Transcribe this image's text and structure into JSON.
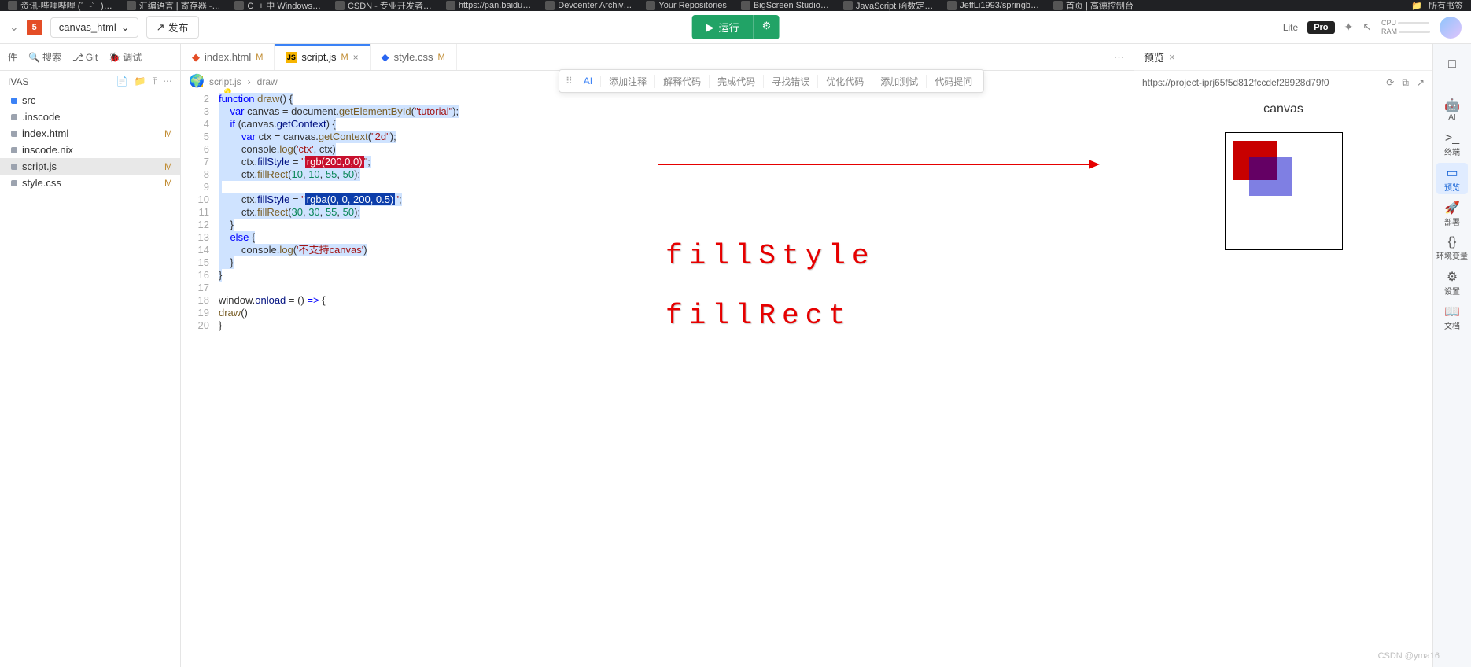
{
  "browser_tabs": [
    "资讯-哔哩哔哩 (゜-゜)…",
    "汇编语言 | 寄存器 -…",
    "C++ 中 Windows…",
    "CSDN - 专业开发者…",
    "https://pan.baidu…",
    "Devcenter Archiv…",
    "Your Repositories",
    "BigScreen Studio…",
    "JavaScript 函数定…",
    "JeffLi1993/springb…",
    "首页 | 高德控制台"
  ],
  "browser_right": "所有书签",
  "toolbar": {
    "project_name": "canvas_html",
    "publish": "发布",
    "run": "运行",
    "lite": "Lite",
    "pro": "Pro",
    "cpu": "CPU",
    "ram": "RAM"
  },
  "left_head": {
    "file": "件",
    "search": "搜索",
    "git": "Git",
    "debug": "调试"
  },
  "tree_title": "IVAS",
  "tree": [
    {
      "name": "src",
      "type": "folder",
      "mod": ""
    },
    {
      "name": ".inscode",
      "type": "file",
      "mod": ""
    },
    {
      "name": "index.html",
      "type": "file",
      "mod": "M"
    },
    {
      "name": "inscode.nix",
      "type": "file",
      "mod": ""
    },
    {
      "name": "script.js",
      "type": "file",
      "mod": "M",
      "active": true
    },
    {
      "name": "style.css",
      "type": "file",
      "mod": "M"
    }
  ],
  "editor_tabs": [
    {
      "label": "index.html",
      "mod": "M",
      "icon": "html"
    },
    {
      "label": "script.js",
      "mod": "M",
      "icon": "js",
      "active": true,
      "closable": true
    },
    {
      "label": "style.css",
      "mod": "M",
      "icon": "css"
    }
  ],
  "breadcrumb": {
    "file": "script.js",
    "symbol": "draw",
    "icon": "JS"
  },
  "helper": [
    "AI",
    "添加注释",
    "解释代码",
    "完成代码",
    "寻找错误",
    "优化代码",
    "添加测试",
    "代码提问"
  ],
  "gutter_start": 2,
  "gutter_end": 20,
  "code_raw": "function draw() {\n    var canvas = document.getElementById(\"tutorial\");\n    if (canvas.getContext) {\n        var ctx = canvas.getContext(\"2d\");\n        console.log('ctx', ctx)\n        ctx.fillStyle = \"rgb(200,0,0)\";\n        ctx.fillRect(10, 10, 55, 50);\n\n        ctx.fillStyle = \"rgba(0, 0, 200, 0.5)\";\n        ctx.fillRect(30, 30, 55, 50);\n    }\n    else {\n        console.log('不支持canvas')\n    }\n}\n\nwindow.onload = () => {\n    draw()\n}",
  "annotations": {
    "a1": "fillStyle",
    "a2": "fillRect"
  },
  "preview": {
    "title": "预览",
    "url": "https://project-iprj65f5d812fccdef28928d79f0",
    "page_title": "canvas"
  },
  "rightbar": [
    {
      "icon": "□",
      "label": ""
    },
    {
      "icon": "🤖",
      "label": "AI"
    },
    {
      "icon": ">_",
      "label": "终端"
    },
    {
      "icon": "▭",
      "label": "预览",
      "active": true
    },
    {
      "icon": "🚀",
      "label": "部署"
    },
    {
      "icon": "{}",
      "label": "环境变量"
    },
    {
      "icon": "⚙",
      "label": "设置"
    },
    {
      "icon": "📖",
      "label": "文档"
    }
  ],
  "watermark": "CSDN @yma16"
}
